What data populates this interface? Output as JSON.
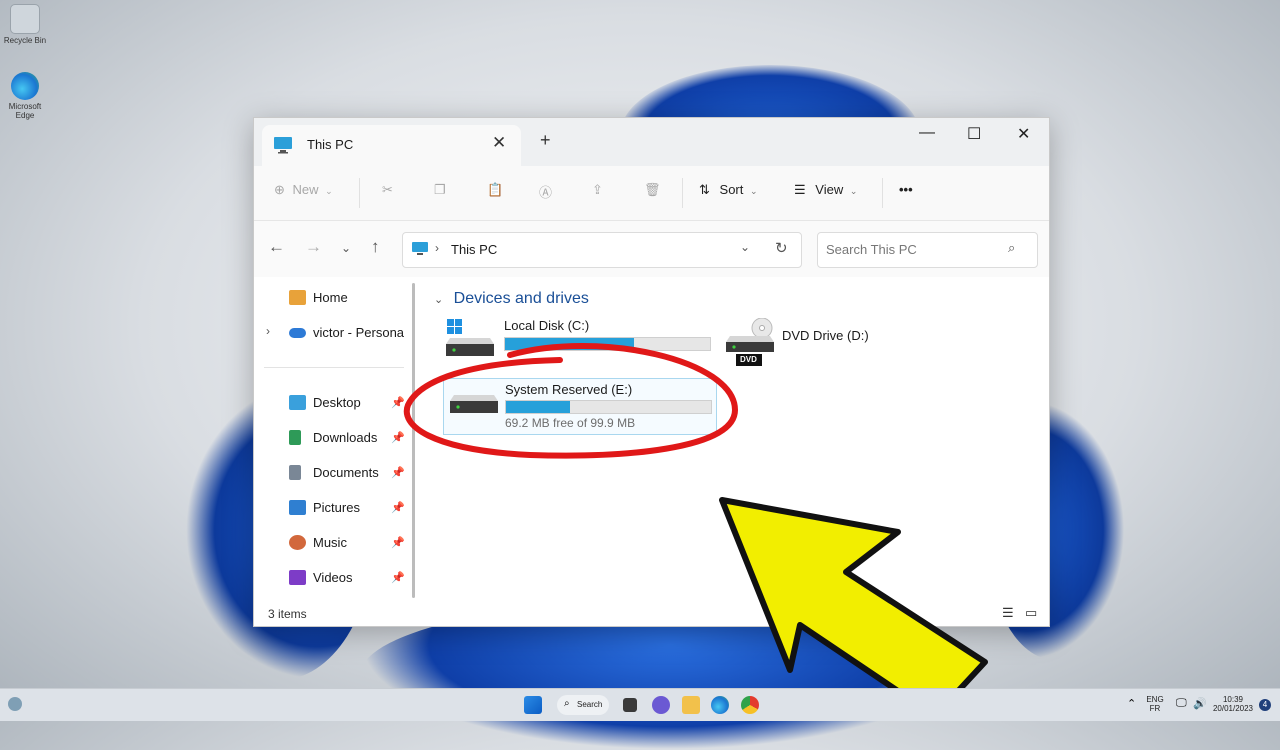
{
  "desktop": {
    "icons": [
      {
        "label": "Recycle Bin"
      },
      {
        "label": "Microsoft Edge"
      }
    ]
  },
  "window": {
    "tab_title": "This PC",
    "toolbar": {
      "new_label": "New",
      "sort_label": "Sort",
      "view_label": "View",
      "more_label": "•••"
    },
    "address": {
      "path": "This PC",
      "search_placeholder": "Search This PC"
    },
    "sidebar": {
      "top_items": [
        {
          "label": "Home",
          "icon": "home-icon"
        },
        {
          "label": "victor - Persona",
          "icon": "onedrive-icon"
        }
      ],
      "quick_access": [
        {
          "label": "Desktop",
          "icon": "desktop-folder-icon"
        },
        {
          "label": "Downloads",
          "icon": "downloads-icon"
        },
        {
          "label": "Documents",
          "icon": "documents-icon"
        },
        {
          "label": "Pictures",
          "icon": "pictures-icon"
        },
        {
          "label": "Music",
          "icon": "music-icon"
        },
        {
          "label": "Videos",
          "icon": "videos-icon"
        }
      ]
    },
    "content": {
      "group_title": "Devices and drives",
      "drives": [
        {
          "name": "Local Disk (C:)",
          "used_fraction": 0.63,
          "detail": ""
        },
        {
          "name": "System Reserved (E:)",
          "used_fraction": 0.31,
          "detail": "69.2 MB free of 99.9 MB"
        },
        {
          "name": "DVD Drive (D:)",
          "badge": "DVD"
        }
      ]
    },
    "status": "3 items"
  },
  "taskbar": {
    "search_label": "Search",
    "lang_top": "ENG",
    "lang_bottom": "FR",
    "time": "10:39",
    "date": "20/01/2023",
    "notif_count": "4"
  },
  "colors": {
    "accent": "#26a0da",
    "annotation_red": "#e01818",
    "arrow_yellow": "#f2ee00"
  }
}
